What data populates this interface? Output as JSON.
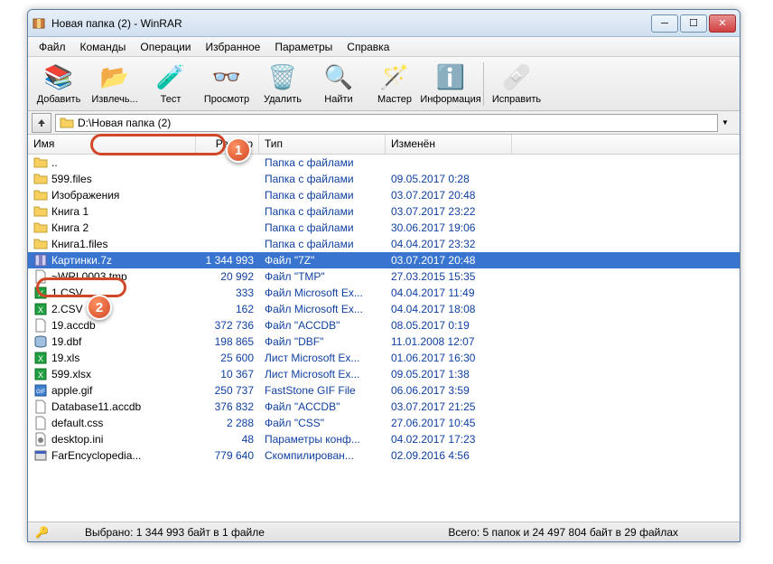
{
  "window": {
    "title": "Новая папка (2) - WinRAR"
  },
  "menu": {
    "items": [
      "Файл",
      "Команды",
      "Операции",
      "Избранное",
      "Параметры",
      "Справка"
    ]
  },
  "toolbar": {
    "add": "Добавить",
    "extract": "Извлечь...",
    "test": "Тест",
    "view": "Просмотр",
    "delete": "Удалить",
    "find": "Найти",
    "wizard": "Мастер",
    "info": "Информация",
    "repair": "Исправить"
  },
  "address": {
    "path": "D:\\Новая папка (2)"
  },
  "columns": {
    "name": "Имя",
    "size": "Размер",
    "type": "Тип",
    "modified": "Изменён"
  },
  "files": [
    {
      "icon": "folder-up",
      "name": "..",
      "size": "",
      "type": "Папка с файлами",
      "date": "",
      "sel": false
    },
    {
      "icon": "folder",
      "name": "599.files",
      "size": "",
      "type": "Папка с файлами",
      "date": "09.05.2017 0:28",
      "sel": false
    },
    {
      "icon": "folder",
      "name": "Изображения",
      "size": "",
      "type": "Папка с файлами",
      "date": "03.07.2017 20:48",
      "sel": false
    },
    {
      "icon": "folder",
      "name": "Книга 1",
      "size": "",
      "type": "Папка с файлами",
      "date": "03.07.2017 23:22",
      "sel": false
    },
    {
      "icon": "folder",
      "name": "Книга 2",
      "size": "",
      "type": "Папка с файлами",
      "date": "30.06.2017 19:06",
      "sel": false
    },
    {
      "icon": "folder",
      "name": "Книга1.files",
      "size": "",
      "type": "Папка с файлами",
      "date": "04.04.2017 23:32",
      "sel": false
    },
    {
      "icon": "archive",
      "name": "Картинки.7z",
      "size": "1 344 993",
      "type": "Файл \"7Z\"",
      "date": "03.07.2017 20:48",
      "sel": true
    },
    {
      "icon": "file",
      "name": "~WRL0003.tmp",
      "size": "20 992",
      "type": "Файл \"TMP\"",
      "date": "27.03.2015 15:35",
      "sel": false
    },
    {
      "icon": "excel",
      "name": "1.CSV",
      "size": "333",
      "type": "Файл Microsoft Ex...",
      "date": "04.04.2017 11:49",
      "sel": false
    },
    {
      "icon": "excel",
      "name": "2.CSV",
      "size": "162",
      "type": "Файл Microsoft Ex...",
      "date": "04.04.2017 18:08",
      "sel": false
    },
    {
      "icon": "file",
      "name": "19.accdb",
      "size": "372 736",
      "type": "Файл \"ACCDB\"",
      "date": "08.05.2017 0:19",
      "sel": false
    },
    {
      "icon": "db",
      "name": "19.dbf",
      "size": "198 865",
      "type": "Файл \"DBF\"",
      "date": "11.01.2008 12:07",
      "sel": false
    },
    {
      "icon": "excel",
      "name": "19.xls",
      "size": "25 600",
      "type": "Лист Microsoft Ex...",
      "date": "01.06.2017 16:30",
      "sel": false
    },
    {
      "icon": "excel",
      "name": "599.xlsx",
      "size": "10 367",
      "type": "Лист Microsoft Ex...",
      "date": "09.05.2017 1:38",
      "sel": false
    },
    {
      "icon": "gif",
      "name": "apple.gif",
      "size": "250 737",
      "type": "FastStone GIF File",
      "date": "06.06.2017 3:59",
      "sel": false
    },
    {
      "icon": "file",
      "name": "Database11.accdb",
      "size": "376 832",
      "type": "Файл \"ACCDB\"",
      "date": "03.07.2017 21:25",
      "sel": false
    },
    {
      "icon": "file",
      "name": "default.css",
      "size": "2 288",
      "type": "Файл \"CSS\"",
      "date": "27.06.2017 10:45",
      "sel": false
    },
    {
      "icon": "ini",
      "name": "desktop.ini",
      "size": "48",
      "type": "Параметры конф...",
      "date": "04.02.2017 17:23",
      "sel": false
    },
    {
      "icon": "exe",
      "name": "FarEncyclopedia...",
      "size": "779 640",
      "type": "Скомпилирован...",
      "date": "02.09.2016 4:56",
      "sel": false
    }
  ],
  "status": {
    "left": "Выбрано: 1 344 993 байт в 1 файле",
    "right": "Всего: 5 папок и 24 497 804 байт в 29 файлах"
  },
  "badges": {
    "1": "1",
    "2": "2"
  }
}
